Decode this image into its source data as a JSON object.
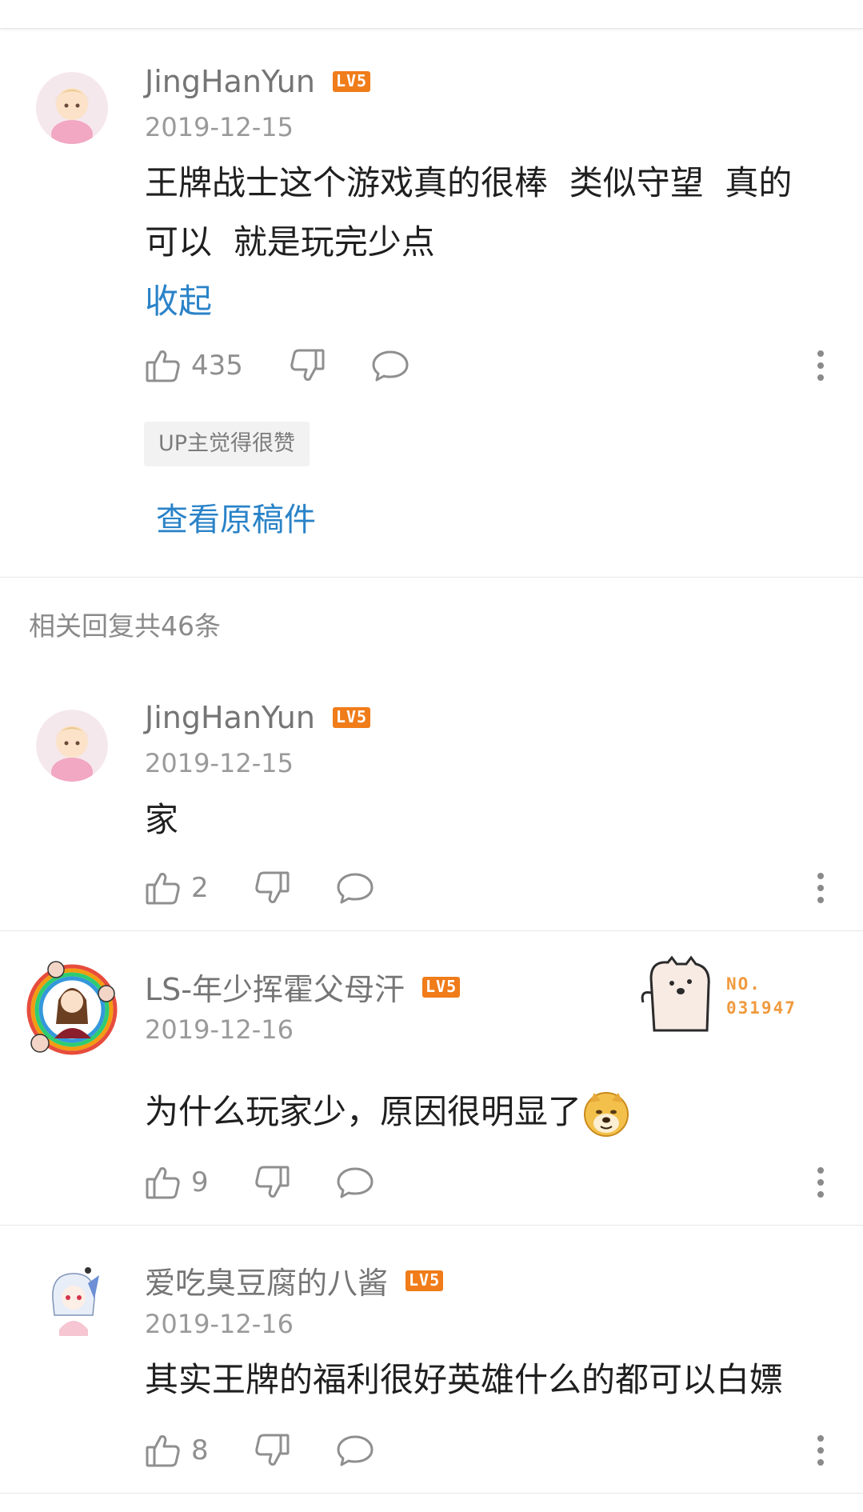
{
  "main_comment": {
    "username": "JingHanYun",
    "level": "LV5",
    "date": "2019-12-15",
    "text_line1": "王牌战士这个游戏真的很棒  类似守望  真的",
    "text_line2": "可以  就是玩完少点",
    "collapse_label": "收起",
    "likes": "435",
    "up_badge": "UP主觉得很赞",
    "view_source": "查看原稿件"
  },
  "reply_count_label": "相关回复共46条",
  "replies": [
    {
      "username": "JingHanYun",
      "level": "LV5",
      "date": "2019-12-15",
      "text": "家",
      "likes": "2"
    },
    {
      "username": "LS-年少挥霍父母汗",
      "level": "LV5",
      "date": "2019-12-16",
      "text": "为什么玩家少，原因很明显了",
      "likes": "9",
      "ornament_no": "NO.",
      "ornament_num": "031947"
    },
    {
      "username": "爱吃臭豆腐的八酱",
      "level": "LV5",
      "date": "2019-12-16",
      "text": "其实王牌的福利很好英雄什么的都可以白嫖",
      "likes": "8"
    }
  ],
  "colors": {
    "link_blue": "#2a83c8",
    "level_orange": "#f07c1a",
    "username_gray": "#757575"
  },
  "icons": [
    "thumbs-up-icon",
    "thumbs-down-icon",
    "comment-bubble-icon",
    "more-vertical-icon",
    "doge-emoji-icon"
  ]
}
